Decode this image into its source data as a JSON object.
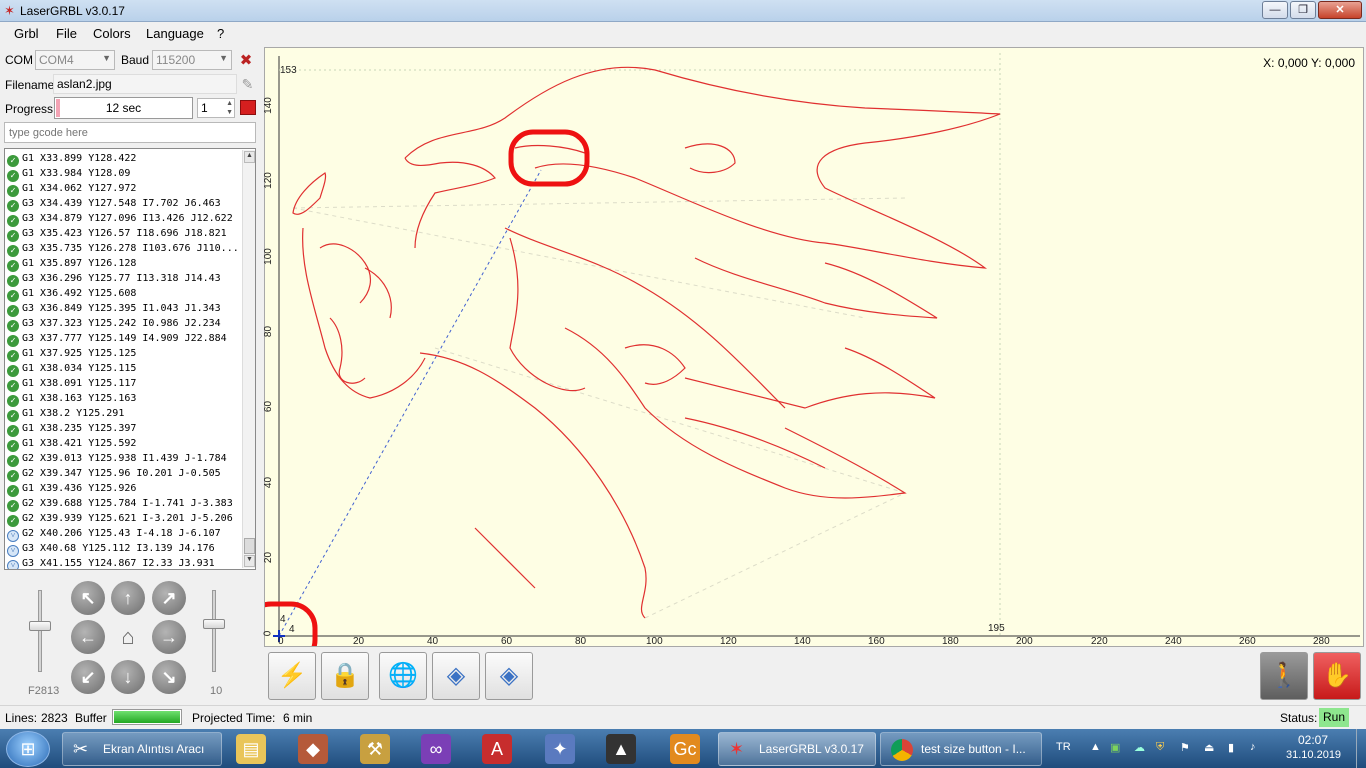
{
  "window": {
    "title": "LaserGRBL v3.0.17",
    "minimize": "—",
    "maximize": "❐",
    "close": "✕"
  },
  "menu": [
    "Grbl",
    "File",
    "Colors",
    "Language",
    "?"
  ],
  "connection": {
    "com_label": "COM",
    "com_value": "COM4",
    "baud_label": "Baud",
    "baud_value": "115200"
  },
  "file": {
    "label": "Filename",
    "value": "aslan2.jpg"
  },
  "progress": {
    "label": "Progress",
    "text": "12 sec",
    "fraction": 0.03,
    "copies": "1"
  },
  "command": {
    "placeholder": "type gcode here"
  },
  "gcode_lines": [
    {
      "text": "G1 X33.899 Y128.422",
      "done": true
    },
    {
      "text": "G1 X33.984 Y128.09",
      "done": true
    },
    {
      "text": "G1 X34.062 Y127.972",
      "done": true
    },
    {
      "text": "G3 X34.439 Y127.548 I7.702 J6.463",
      "done": true
    },
    {
      "text": "G3 X34.879 Y127.096 I13.426 J12.622",
      "done": true
    },
    {
      "text": "G3 X35.423 Y126.57 I18.696 J18.821",
      "done": true
    },
    {
      "text": "G3 X35.735 Y126.278 I103.676 J110...",
      "done": true
    },
    {
      "text": "G1 X35.897 Y126.128",
      "done": true
    },
    {
      "text": "G3 X36.296 Y125.77 I13.318 J14.43",
      "done": true
    },
    {
      "text": "G1 X36.492 Y125.608",
      "done": true
    },
    {
      "text": "G3 X36.849 Y125.395 I1.043 J1.343",
      "done": true
    },
    {
      "text": "G3 X37.323 Y125.242 I0.986 J2.234",
      "done": true
    },
    {
      "text": "G3 X37.777 Y125.149 I4.909 J22.884",
      "done": true
    },
    {
      "text": "G1 X37.925 Y125.125",
      "done": true
    },
    {
      "text": "G1 X38.034 Y125.115",
      "done": true
    },
    {
      "text": "G1 X38.091 Y125.117",
      "done": true
    },
    {
      "text": "G1 X38.163 Y125.163",
      "done": true
    },
    {
      "text": "G1 X38.2 Y125.291",
      "done": true
    },
    {
      "text": "G1 X38.235 Y125.397",
      "done": true
    },
    {
      "text": "G1 X38.421 Y125.592",
      "done": true
    },
    {
      "text": "G2 X39.013 Y125.938 I1.439 J-1.784",
      "done": true
    },
    {
      "text": "G2 X39.347 Y125.96 I0.201 J-0.505",
      "done": true
    },
    {
      "text": "G1 X39.436 Y125.926",
      "done": true
    },
    {
      "text": "G2 X39.688 Y125.784 I-1.741 J-3.383",
      "done": true
    },
    {
      "text": "G2 X39.939 Y125.621 I-3.201 J-5.206",
      "done": true
    },
    {
      "text": "G2 X40.206 Y125.43 I-4.18 J-6.107",
      "done": false
    },
    {
      "text": "G3 X40.68 Y125.112 I3.139 J4.176",
      "done": false
    },
    {
      "text": "G3 X41.155 Y124.867 I2.33 J3.931",
      "done": false
    }
  ],
  "jog": {
    "feed_label": "F2813",
    "step_label": "10"
  },
  "canvas": {
    "coords": "X: 0,000 Y: 0,000",
    "y_ticks": [
      "0",
      "20",
      "40",
      "60",
      "80",
      "100",
      "120",
      "140"
    ],
    "x_ticks": [
      "0",
      "20",
      "40",
      "60",
      "80",
      "100",
      "120",
      "140",
      "160",
      "180",
      "200",
      "220",
      "240",
      "260",
      "280"
    ],
    "max_y_label": "153",
    "max_x_label": "195",
    "origin_x_label": "4",
    "origin_y_label": "4"
  },
  "statusbar": {
    "lines_label": "Lines:",
    "lines_value": "2823",
    "buffer_label": "Buffer",
    "buffer_fill": 1.0,
    "projected_label": "Projected Time:",
    "projected_value": "6 min",
    "status_label": "Status:",
    "status_value": "Run"
  },
  "taskbar": {
    "items": [
      {
        "label": "Ekran Alıntısı Aracı"
      },
      {
        "label": "LaserGRBL v3.0.17"
      },
      {
        "label": "test size button - I..."
      }
    ],
    "lang": "TR",
    "time": "02:07",
    "date": "31.10.2019"
  },
  "colors": {
    "accent_red": "#dd2b2b",
    "canvas_bg": "#fefee4",
    "status_run_bg": "#8ee68e"
  }
}
